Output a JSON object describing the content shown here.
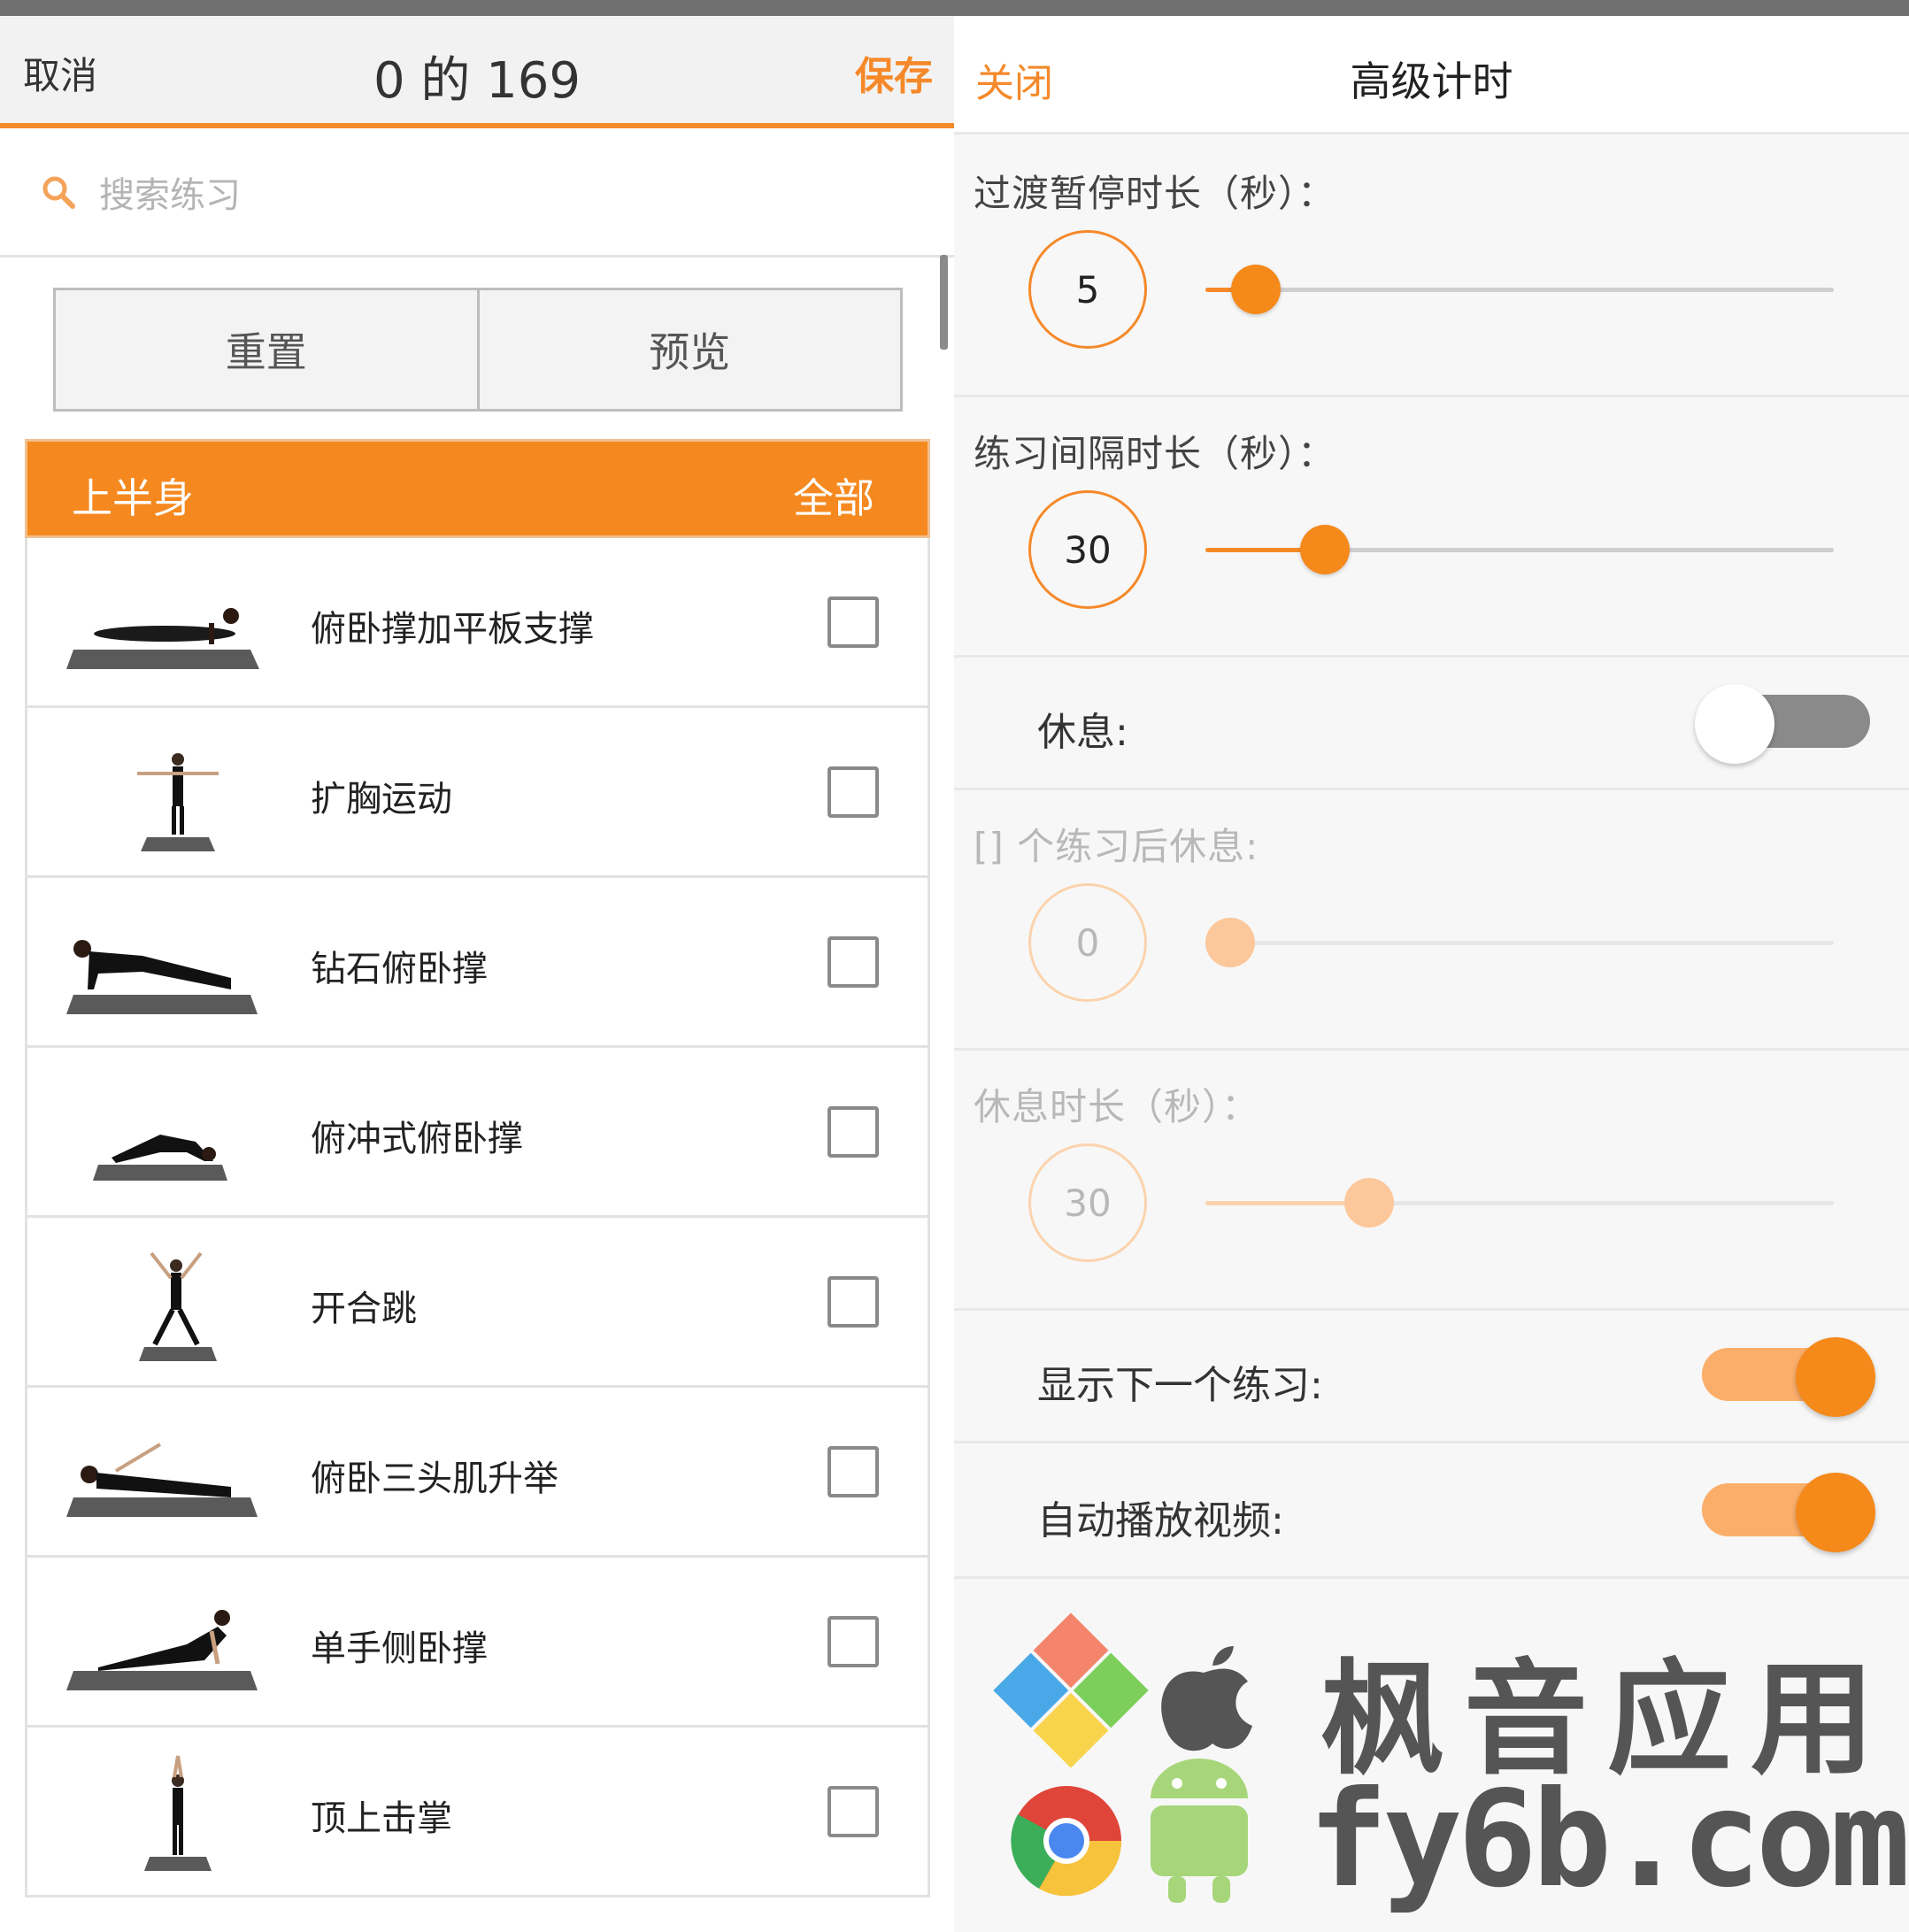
{
  "left": {
    "header": {
      "cancel": "取消",
      "title": "0 的 169",
      "save": "保存"
    },
    "search": {
      "placeholder": "搜索练习"
    },
    "buttons": {
      "reset": "重置",
      "preview": "预览"
    },
    "category": {
      "name": "上半身",
      "all": "全部"
    },
    "exercises": [
      {
        "label": "俯卧撑加平板支撑",
        "checked": false
      },
      {
        "label": "扩胸运动",
        "checked": false
      },
      {
        "label": "钻石俯卧撑",
        "checked": false
      },
      {
        "label": "俯冲式俯卧撑",
        "checked": false
      },
      {
        "label": "开合跳",
        "checked": false
      },
      {
        "label": "俯卧三头肌升举",
        "checked": false
      },
      {
        "label": "单手侧卧撑",
        "checked": false
      },
      {
        "label": "顶上击掌",
        "checked": false
      }
    ]
  },
  "right": {
    "header": {
      "close": "关闭",
      "title": "高级计时"
    },
    "transition": {
      "label": "过渡暂停时长（秒）：",
      "value": "5",
      "fraction": 0.08
    },
    "interval": {
      "label": "练习间隔时长（秒）：",
      "value": "30",
      "fraction": 0.19
    },
    "rest": {
      "label": "休息:",
      "on": false
    },
    "rest_after": {
      "label": "[] 个练习后休息:",
      "value": "0",
      "fraction": 0.04
    },
    "rest_duration": {
      "label": "休息时长（秒）：",
      "value": "30",
      "fraction": 0.26
    },
    "show_next": {
      "label": "显示下一个练习:",
      "on": true
    },
    "autoplay": {
      "label": "自动播放视频:",
      "on": true
    }
  },
  "watermark": {
    "brand": "枫音应用",
    "site": "fy6b.com"
  },
  "colors": {
    "accent": "#f5892a",
    "header_bg": "#f2f2f2"
  }
}
